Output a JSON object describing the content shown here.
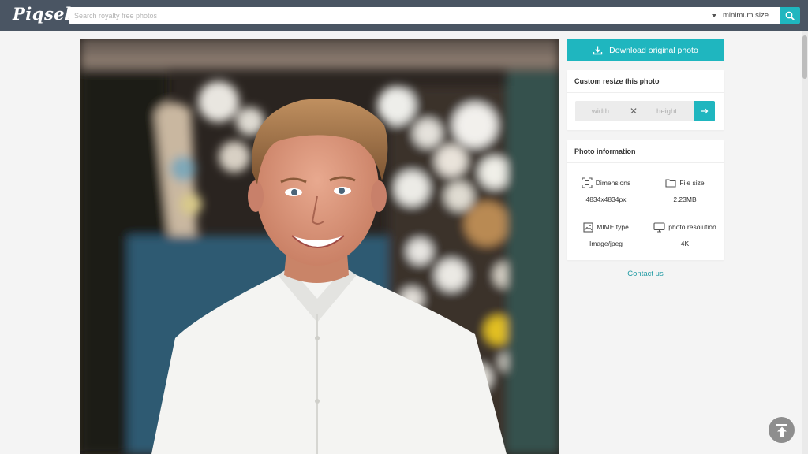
{
  "header": {
    "logo_text": "Piqsels",
    "search": {
      "placeholder": "Search royalty free photos",
      "value": ""
    },
    "size_filter": {
      "selected": "minimum size"
    },
    "search_icon": "search-icon",
    "colors": {
      "header_bg": "#4a5563",
      "accent": "#1fb6bf"
    }
  },
  "photo": {
    "subject": "portrait-photo"
  },
  "sidebar": {
    "download_label": "Download original photo",
    "resize": {
      "title": "Custom resize this photo",
      "width_placeholder": "width",
      "height_placeholder": "height",
      "separator": "✕"
    },
    "info": {
      "title": "Photo information",
      "items": [
        {
          "label": "Dimensions",
          "value": "4834x4834px",
          "icon": "dimensions-icon"
        },
        {
          "label": "File size",
          "value": "2.23MB",
          "icon": "folder-icon"
        },
        {
          "label": "MIME type",
          "value": "Image/jpeg",
          "icon": "image-icon"
        },
        {
          "label": "photo resolution",
          "value": "4K",
          "icon": "monitor-icon"
        }
      ]
    },
    "contact_label": "Contact us"
  },
  "back_to_top_icon": "arrow-up-icon"
}
